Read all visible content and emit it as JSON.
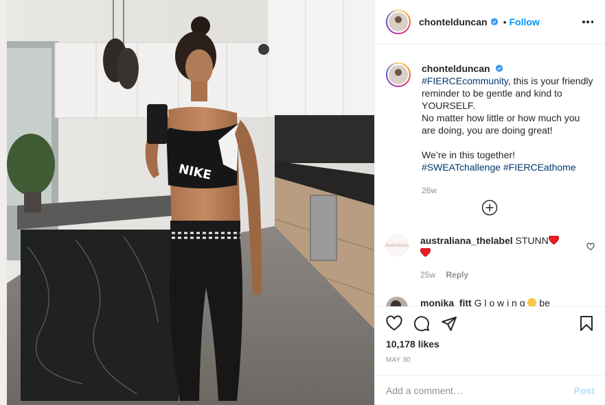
{
  "post": {
    "username": "chontelduncan",
    "follow_label": "Follow",
    "more_icon": "more-options-icon",
    "dot": "•"
  },
  "caption": {
    "username": "chontelduncan",
    "hashtag_1": "#FIERCEcommunity",
    "line_1": ", this is your friendly reminder to be gentle and kind to YOURSELF.",
    "line_2": "No matter how little or how much you are doing, you are doing great!",
    "line_3": "We’re in this together!",
    "hashtag_2": "#SWEATchallenge",
    "hashtag_3": "#FIERCEathome",
    "time": "26w"
  },
  "load_more_icon": "plus-circle-icon",
  "comments": [
    {
      "username": "australiana_thelabel",
      "text": "STUNN",
      "avatar_text": "Australiana",
      "time": "25w",
      "reply_label": "Reply"
    },
    {
      "username": "monika_fitt",
      "text": "G l o w i n g",
      "suffix": "be"
    }
  ],
  "actions": {
    "like_icon": "heart-icon",
    "comment_icon": "comment-icon",
    "share_icon": "share-icon",
    "save_icon": "bookmark-icon"
  },
  "likes": "10,178 likes",
  "date": "MAY 30",
  "add_comment": {
    "placeholder": "Add a comment…",
    "post_label": "Post"
  },
  "colors": {
    "link_blue": "#0095f6",
    "hashtag": "#00376b",
    "muted": "#8e8e8e",
    "post_disabled": "#b2dffc",
    "heart_red": "#ed1c24"
  }
}
